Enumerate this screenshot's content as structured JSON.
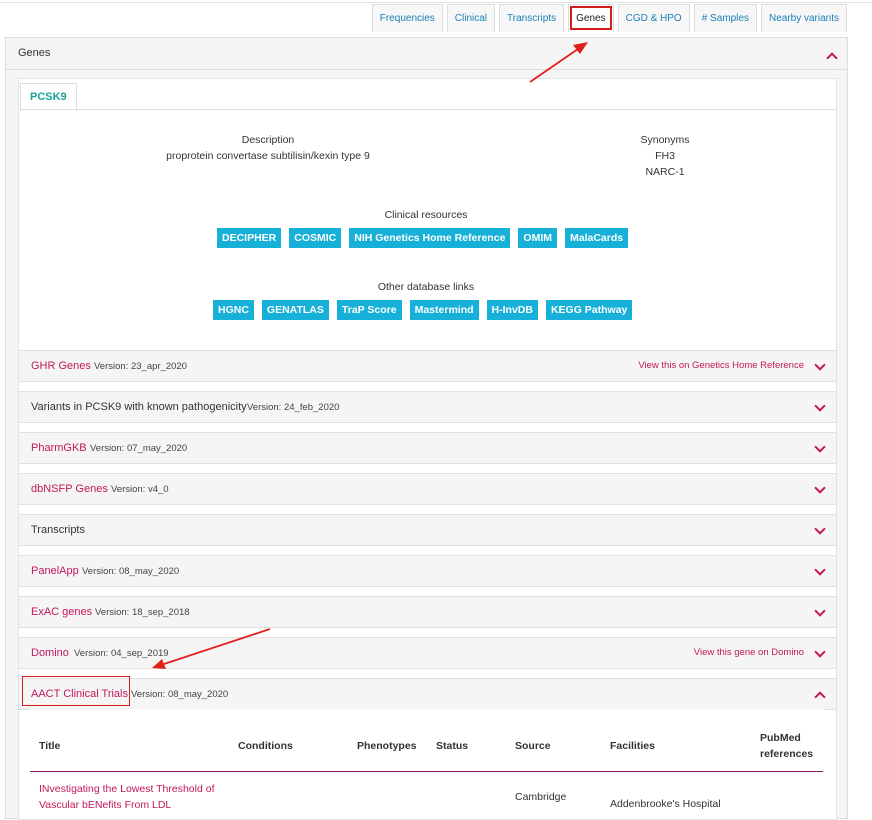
{
  "tabs": [
    {
      "label": "Frequencies",
      "active": false
    },
    {
      "label": "Clinical",
      "active": false
    },
    {
      "label": "Transcripts",
      "active": false
    },
    {
      "label": "Genes",
      "active": true
    },
    {
      "label": "CGD & HPO",
      "active": false
    },
    {
      "label": "# Samples",
      "active": false
    },
    {
      "label": "Nearby variants",
      "active": false
    }
  ],
  "genes_panel": {
    "title": "Genes"
  },
  "gene": {
    "tab": "PCSK9",
    "description_label": "Description",
    "description": "proprotein convertase subtilisin/kexin type 9",
    "synonyms_label": "Synonyms",
    "synonyms": [
      "FH3",
      "NARC-1"
    ],
    "clinical_resources_label": "Clinical resources",
    "clinical_resources": [
      "DECIPHER",
      "COSMIC",
      "NIH Genetics Home Reference",
      "OMIM",
      "MalaCards"
    ],
    "other_links_label": "Other database links",
    "other_links": [
      "HGNC",
      "GENATLAS",
      "TraP Score",
      "Mastermind",
      "H-InvDB",
      "KEGG Pathway"
    ]
  },
  "sections": [
    {
      "title": "GHR Genes",
      "version": "Version: 23_apr_2020",
      "link": "View this on Genetics Home Reference"
    },
    {
      "title": "Variants in PCSK9 with known pathogenicity",
      "version": "Version: 24_feb_2020"
    },
    {
      "title": "PharmGKB",
      "version": "Version: 07_may_2020"
    },
    {
      "title": "dbNSFP Genes",
      "version": "Version: v4_0"
    },
    {
      "title": "Transcripts",
      "version": ""
    },
    {
      "title": "PanelApp",
      "version": "Version: 08_may_2020"
    },
    {
      "title": "ExAC genes",
      "version": "Version: 18_sep_2018"
    },
    {
      "title": "Domino",
      "version": "Version: 04_sep_2019",
      "link": "View this gene on Domino"
    },
    {
      "title": "AACT Clinical Trials",
      "version": "Version: 08_may_2020"
    }
  ],
  "trials_table": {
    "headers": {
      "title": "Title",
      "conditions": "Conditions",
      "phenotypes": "Phenotypes",
      "status": "Status",
      "source": "Source",
      "facilities": "Facilities",
      "pubmed_1": "PubMed",
      "pubmed_2": "references"
    },
    "row": {
      "title_1": "INvestigating the Lowest Threshold of",
      "title_2": "Vascular bENefits From LDL",
      "source": "Cambridge",
      "facilities": "Addenbrooke's Hospital"
    }
  },
  "colors": {
    "accent": "#c2185b",
    "link_blue": "#1c7fb5",
    "button_cyan": "#16b0d8",
    "teal": "#1aa39a",
    "annotation_red": "#e02020"
  }
}
